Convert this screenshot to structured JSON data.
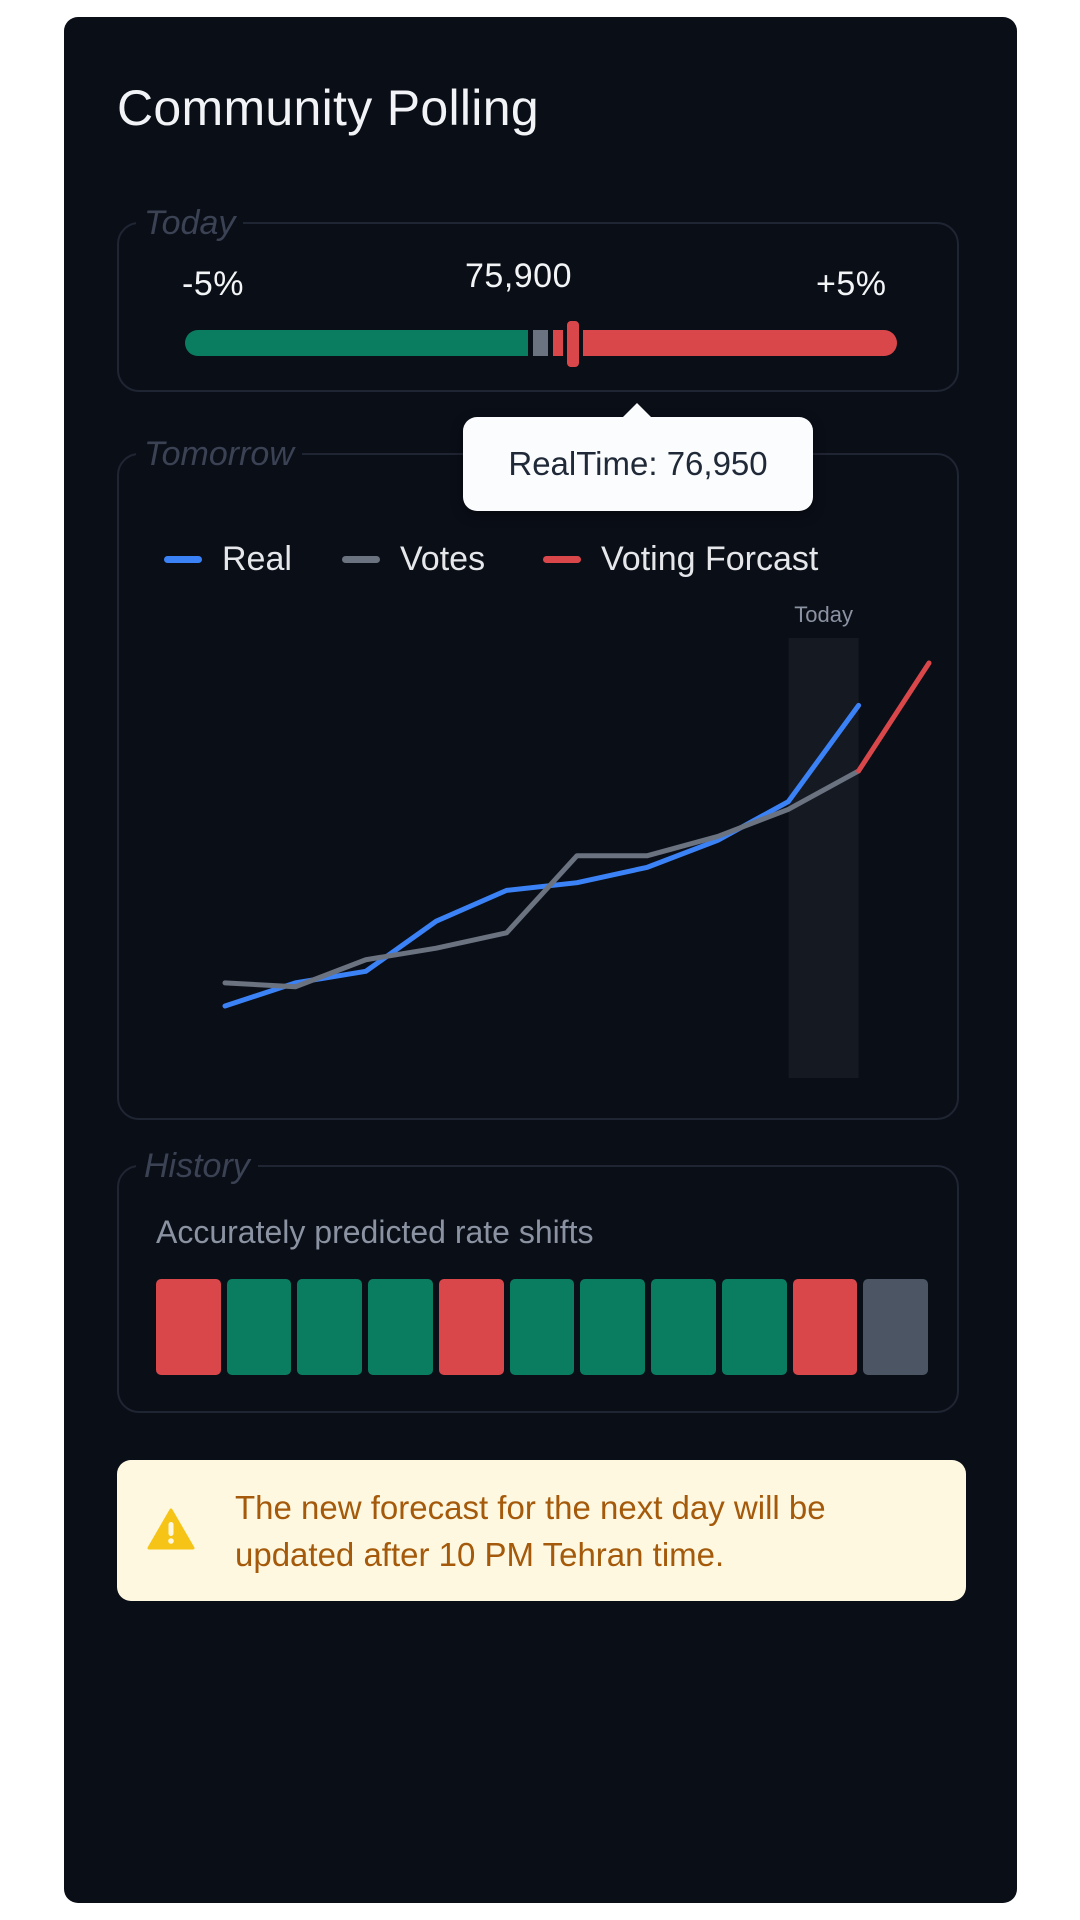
{
  "app": {
    "title": "Community Polling"
  },
  "today": {
    "legend": "Today",
    "min_label": "-5%",
    "max_label": "+5%",
    "value_label": "75,900",
    "tooltip": "RealTime: 76,950"
  },
  "tomorrow": {
    "legend": "Tomorrow",
    "series_labels": [
      "Real",
      "Votes",
      "Voting Forcast"
    ],
    "today_marker": "Today"
  },
  "history": {
    "legend": "History",
    "caption": "Accurately predicted rate shifts",
    "outcomes": [
      "miss",
      "hit",
      "hit",
      "hit",
      "miss",
      "hit",
      "hit",
      "hit",
      "hit",
      "miss",
      "pending"
    ]
  },
  "notice": {
    "text": "The new forecast for the next day will be updated after 10 PM Tehran time."
  },
  "colors": {
    "background": "#0a0e17",
    "green": "#0a7d61",
    "red": "#d9474b",
    "gray": "#6b7280",
    "real_line": "#3b82f6",
    "votes_line": "#6b7280",
    "forecast_line": "#d9474b",
    "pending": "#4b5563",
    "warning": "#f6c416"
  },
  "chart_data": {
    "type": "line",
    "x": [
      1,
      2,
      3,
      4,
      5,
      6,
      7,
      8,
      9,
      10,
      11
    ],
    "series": [
      {
        "name": "Real",
        "color": "#3b82f6",
        "values": [
          0,
          6,
          9,
          22,
          30,
          32,
          36,
          43,
          53,
          78,
          null
        ]
      },
      {
        "name": "Votes",
        "color": "#6b7280",
        "values": [
          6,
          5,
          12,
          15,
          19,
          39,
          39,
          44,
          51,
          61,
          null
        ]
      },
      {
        "name": "Voting Forcast",
        "color": "#d9474b",
        "values": [
          null,
          null,
          null,
          null,
          null,
          null,
          null,
          null,
          null,
          61,
          89
        ]
      }
    ],
    "highlight": {
      "label": "Today",
      "x": 10
    },
    "grid": false,
    "legend_position": "top"
  }
}
